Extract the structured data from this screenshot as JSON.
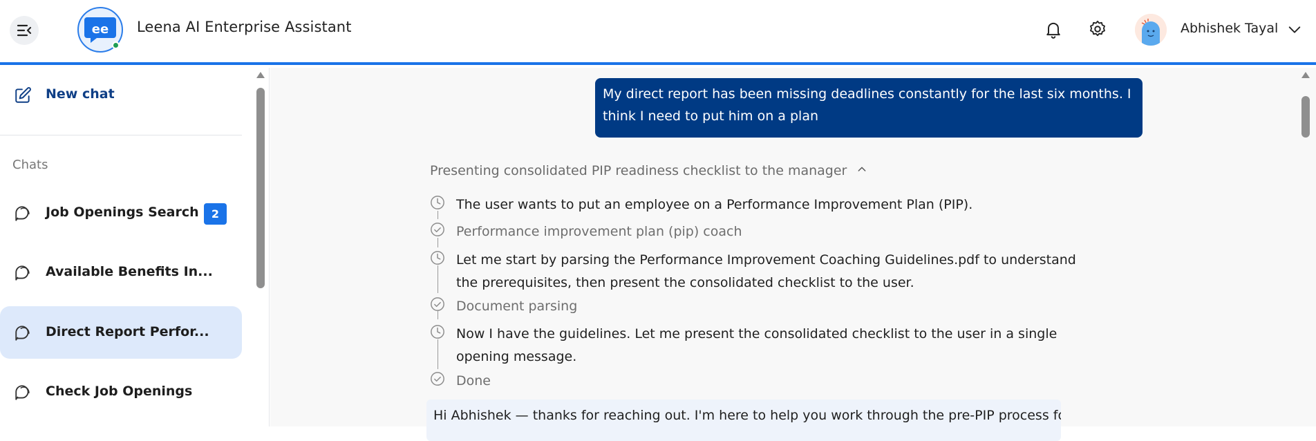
{
  "header": {
    "app_title": "Leena AI Enterprise Assistant",
    "user_name": "Abhishek Tayal",
    "accent": "#1a73e8",
    "icons": [
      "collapse-menu-icon",
      "bell-icon",
      "gear-icon",
      "chevron-down-icon"
    ]
  },
  "sidebar": {
    "new_chat_label": "New chat",
    "chats_heading": "Chats",
    "items": [
      {
        "label": "Job Openings Search",
        "badge": "2"
      },
      {
        "label": "Available Benefits In..."
      },
      {
        "label": "Direct Report Perfor...",
        "active": true
      },
      {
        "label": "Check Job Openings"
      }
    ]
  },
  "main": {
    "user_message": "My direct report has been missing deadlines constantly for the last six months. I think I need to put him on a plan",
    "steps_heading": "Presenting consolidated PIP readiness checklist to the manager",
    "steps": [
      {
        "kind": "thought",
        "text": "The user wants to put an employee on a Performance Improvement Plan (PIP)."
      },
      {
        "kind": "tool",
        "text": "Performance improvement plan (pip) coach"
      },
      {
        "kind": "thought",
        "line1": "Let me start by parsing the Performance Improvement Coaching Guidelines.pdf to understand",
        "line2": "the prerequisites, then present the consolidated checklist to the user."
      },
      {
        "kind": "tool",
        "text": "Document parsing"
      },
      {
        "kind": "thought",
        "line1": "Now I have the guidelines. Let me present the consolidated checklist to the user in a single",
        "line2": "opening message."
      },
      {
        "kind": "tool",
        "text": "Done"
      }
    ],
    "assistant_reply": "Hi Abhishek — thanks for reaching out. I'm here to help you work through the pre-PIP process for"
  }
}
